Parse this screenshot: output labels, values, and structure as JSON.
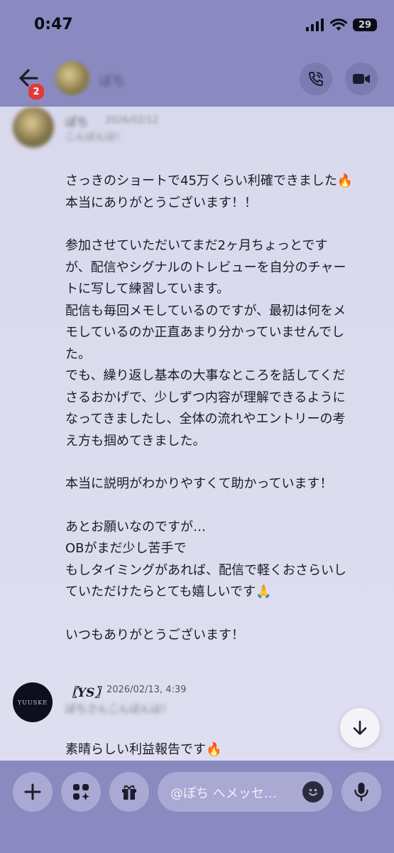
{
  "status": {
    "time": "0:47",
    "battery": "29"
  },
  "header": {
    "badge_count": "2",
    "user_name": "ぽち"
  },
  "top_message": {
    "name": "ぽち",
    "time": "2026/02/12",
    "preview": "こんばんは！"
  },
  "message": {
    "paragraphs": [
      [
        "さっきのショートで45万くらい利確できました🔥",
        "本当にありがとうございます！！"
      ],
      [
        "参加させていただいてまだ2ヶ月ちょっとです",
        "が、配信やシグナルのトレビューを自分のチャー",
        "トに写して練習しています。",
        "配信も毎回メモしているのですが、最初は何をメ",
        "モしているのか正直あまり分かっていませんでし",
        "た。",
        "でも、繰り返し基本の大事なところを話してくだ",
        "さるおかげで、少しずつ内容が理解できるように",
        "なってきましたし、全体の流れやエントリーの考",
        "え方も掴めてきました。"
      ],
      [
        "本当に説明がわかりやすくて助かっています！"
      ],
      [
        "あとお願いなのですが…",
        "OBがまだ少し苦手で",
        "もしタイミングがあれば、配信で軽くおさらいし",
        "ていただけたらとても嬉しいです🙏"
      ],
      [
        "いつもありがとうございます！"
      ]
    ]
  },
  "reply": {
    "avatar_text": "YUUSKE",
    "name": "〖YS〗",
    "time": "2026/02/13, 4:39",
    "preview": "ぽちさんこんばんは！",
    "text": "素晴らしい利益報告です🔥"
  },
  "composer": {
    "placeholder": "@ぽち へメッセ…"
  },
  "icons": {
    "back": "arrow-left-icon",
    "call": "phone-call-icon",
    "video": "video-camera-icon",
    "add": "plus-icon",
    "apps": "apps-sparkle-icon",
    "gift": "gift-icon",
    "emoji": "emoji-icon",
    "mic": "microphone-icon",
    "scroll": "arrow-down-icon"
  }
}
